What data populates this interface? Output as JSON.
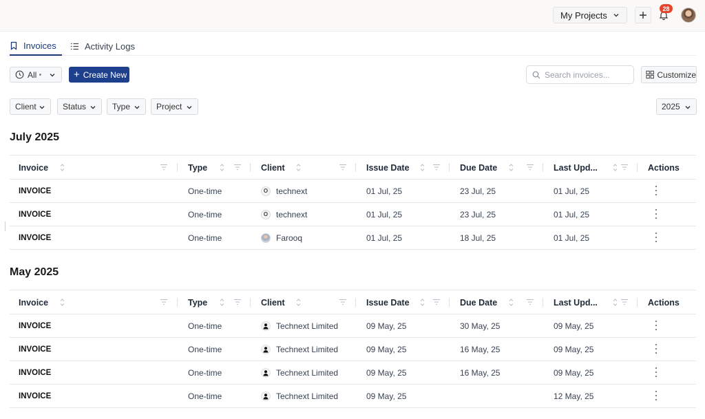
{
  "header": {
    "project_selector": "My Projects",
    "notification_count": "28"
  },
  "tabs": [
    {
      "label": "Invoices",
      "active": true
    },
    {
      "label": "Activity Logs",
      "active": false
    }
  ],
  "toolbar": {
    "all_label": "All",
    "create_label": "Create New",
    "search_placeholder": "Search invoices...",
    "customize_label": "Customize"
  },
  "filters": {
    "client": "Client",
    "status": "Status",
    "type": "Type",
    "project": "Project",
    "year": "2025"
  },
  "columns": [
    "Invoice",
    "Type",
    "Client",
    "Issue Date",
    "Due Date",
    "Last Upd...",
    "Actions"
  ],
  "sections": [
    {
      "title": "July 2025",
      "rows": [
        {
          "invoice": "INVOICE",
          "type": "One-time",
          "client": "technext",
          "client_icon": "letter-o-icon",
          "issue": "01 Jul, 25",
          "due": "23 Jul, 25",
          "updated": "01 Jul, 25"
        },
        {
          "invoice": "INVOICE",
          "type": "One-time",
          "client": "technext",
          "client_icon": "letter-o-icon",
          "issue": "01 Jul, 25",
          "due": "23 Jul, 25",
          "updated": "01 Jul, 25"
        },
        {
          "invoice": "INVOICE",
          "type": "One-time",
          "client": "Farooq",
          "client_icon": "photo-avatar-icon",
          "issue": "01 Jul, 25",
          "due": "18 Jul, 25",
          "updated": "01 Jul, 25"
        }
      ]
    },
    {
      "title": "May 2025",
      "rows": [
        {
          "invoice": "INVOICE",
          "type": "One-time",
          "client": "Technext Limited",
          "client_icon": "person-icon",
          "issue": "09 May, 25",
          "due": "30 May, 25",
          "updated": "09 May, 25"
        },
        {
          "invoice": "INVOICE",
          "type": "One-time",
          "client": "Technext Limited",
          "client_icon": "person-icon",
          "issue": "09 May, 25",
          "due": "16 May, 25",
          "updated": "09 May, 25"
        },
        {
          "invoice": "INVOICE",
          "type": "One-time",
          "client": "Technext Limited",
          "client_icon": "person-icon",
          "issue": "09 May, 25",
          "due": "16 May, 25",
          "updated": "09 May, 25"
        },
        {
          "invoice": "INVOICE",
          "type": "One-time",
          "client": "Technext Limited",
          "client_icon": "person-icon",
          "issue": "09 May, 25",
          "due": "",
          "updated": "12 May, 25"
        }
      ]
    }
  ],
  "colors": {
    "accent": "#1e3f8c",
    "badge": "#e2452c"
  }
}
